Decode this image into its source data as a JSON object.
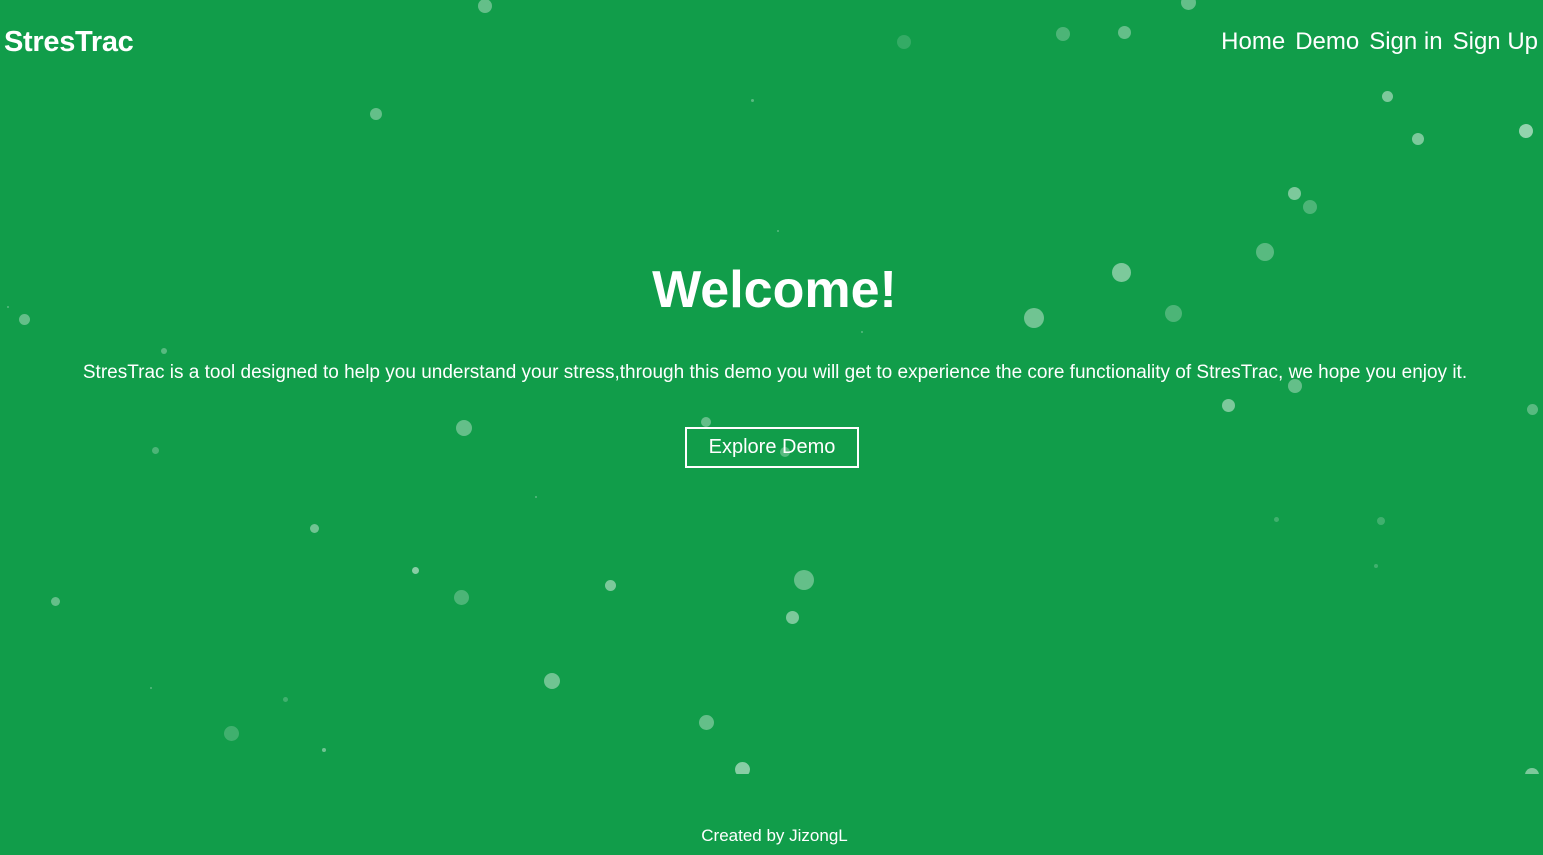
{
  "brand": {
    "name": "StresTrac"
  },
  "nav": {
    "items": [
      {
        "label": "Home"
      },
      {
        "label": "Demo"
      },
      {
        "label": "Sign in"
      },
      {
        "label": "Sign Up"
      }
    ]
  },
  "hero": {
    "title": "Welcome!",
    "description": "StresTrac is a tool designed to help you understand your stress,through this demo you will get to experience the core functionality of StresTrac, we hope you enjoy it.",
    "cta_label": "Explore Demo"
  },
  "footer": {
    "text": "Created by JizongL"
  },
  "colors": {
    "background": "#119d4a",
    "text": "#ffffff",
    "particles": "#ffffff"
  }
}
